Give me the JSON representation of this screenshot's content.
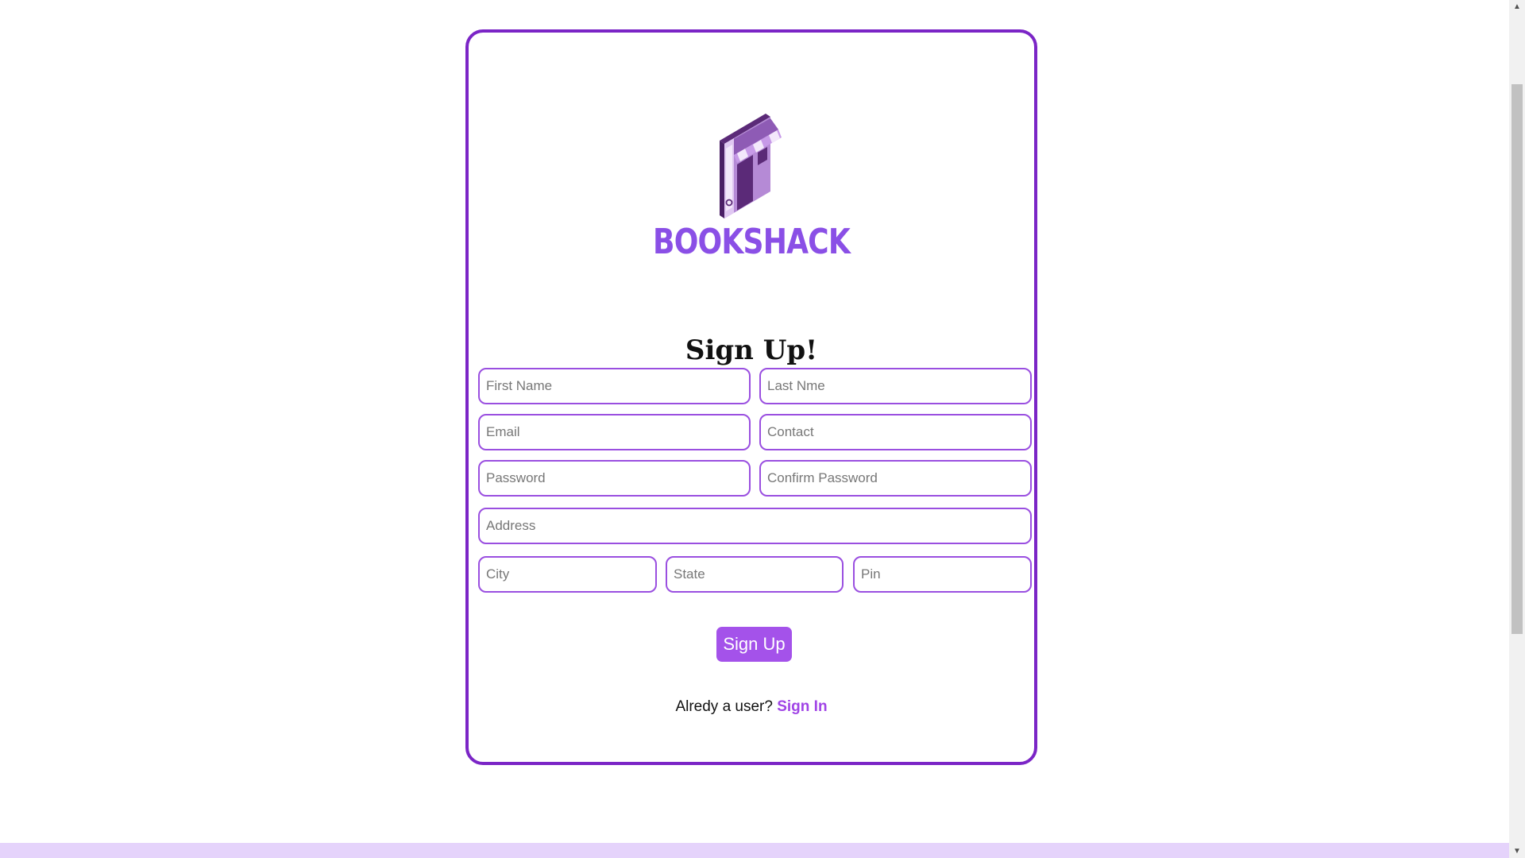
{
  "brand": {
    "name": "BOOKSHACK",
    "logo_icon": "bookshop-icon",
    "color": "#8a4fe6"
  },
  "form": {
    "title": "Sign Up!",
    "fields": {
      "first_name": "First Name",
      "last_name": "Last Nme",
      "email": "Email",
      "contact": "Contact",
      "password": "Password",
      "confirm_password": "Confirm Password",
      "address": "Address",
      "city": "City",
      "state": "State",
      "pin": "Pin"
    },
    "submit_label": "Sign Up",
    "signin_prompt": "Alredy a user?",
    "signin_link": "Sign In"
  },
  "colors": {
    "card_border": "#7b25c6",
    "field_border": "#9a4fe0",
    "button": "#a452ea",
    "link": "#a044e6",
    "footer": "#e5d3fb"
  }
}
